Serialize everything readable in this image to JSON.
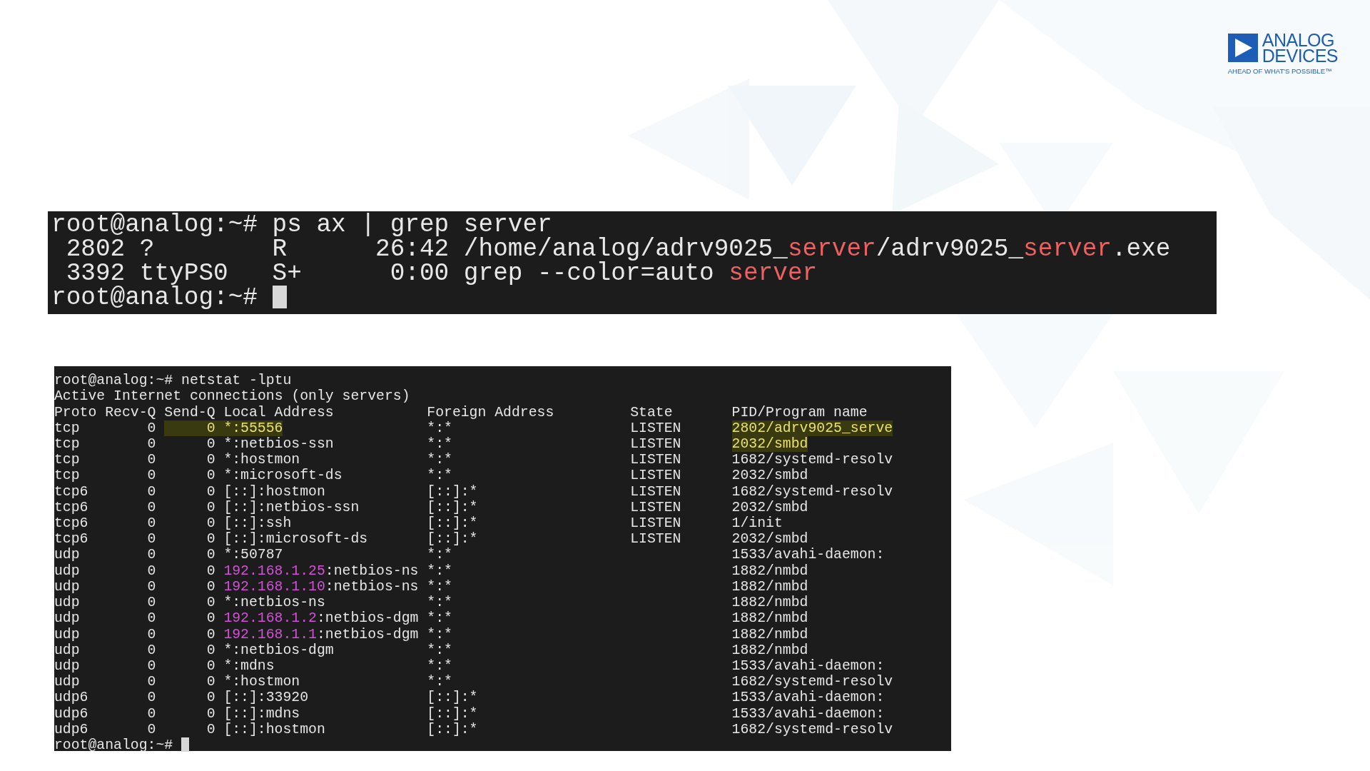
{
  "logo": {
    "name_lines": [
      "ANALOG",
      "DEVICES"
    ],
    "tagline": "AHEAD OF WHAT'S POSSIBLE™"
  },
  "terminal_1": {
    "lines": [
      [
        {
          "text": "root@analog:~# ps ax | grep server",
          "kind": "plain"
        }
      ],
      [
        {
          "text": " 2802 ?        R      26:42 /home/analog/adrv9025_",
          "kind": "plain"
        },
        {
          "text": "server",
          "kind": "match"
        },
        {
          "text": "/adrv9025_",
          "kind": "plain"
        },
        {
          "text": "server",
          "kind": "match"
        },
        {
          "text": ".exe",
          "kind": "plain"
        }
      ],
      [
        {
          "text": " 3392 ttyPS0   S+      0:00 grep --color=auto ",
          "kind": "plain"
        },
        {
          "text": "server",
          "kind": "match"
        }
      ],
      [
        {
          "text": "root@analog:~# ",
          "kind": "plain"
        }
      ]
    ],
    "cursor": true
  },
  "terminal_2": {
    "command": "root@analog:~# netstat -lptu",
    "title": "Active Internet connections (only servers)",
    "columns": [
      "Proto",
      "Recv-Q",
      "Send-Q",
      "Local Address",
      "Foreign Address",
      "State",
      "PID/Program name"
    ],
    "rows": [
      {
        "proto": "tcp",
        "recv_q": "0",
        "send_q": "0",
        "local": [
          {
            "text": "*:55556",
            "kind": "plain"
          }
        ],
        "foreign": "*:*",
        "state": "LISTEN",
        "program": "2802/adrv9025_serve",
        "address_highlighted": true,
        "program_highlighted": true
      },
      {
        "proto": "tcp",
        "recv_q": "0",
        "send_q": "0",
        "local": [
          {
            "text": "*:netbios-ssn",
            "kind": "plain"
          }
        ],
        "foreign": "*:*",
        "state": "LISTEN",
        "program": "2032/smbd",
        "address_highlighted": false,
        "program_highlighted": true
      },
      {
        "proto": "tcp",
        "recv_q": "0",
        "send_q": "0",
        "local": [
          {
            "text": "*:hostmon",
            "kind": "plain"
          }
        ],
        "foreign": "*:*",
        "state": "LISTEN",
        "program": "1682/systemd-resolv",
        "address_highlighted": false,
        "program_highlighted": false
      },
      {
        "proto": "tcp",
        "recv_q": "0",
        "send_q": "0",
        "local": [
          {
            "text": "*:microsoft-ds",
            "kind": "plain"
          }
        ],
        "foreign": "*:*",
        "state": "LISTEN",
        "program": "2032/smbd",
        "address_highlighted": false,
        "program_highlighted": false
      },
      {
        "proto": "tcp6",
        "recv_q": "0",
        "send_q": "0",
        "local": [
          {
            "text": "[::]:hostmon",
            "kind": "plain"
          }
        ],
        "foreign": "[::]:*",
        "state": "LISTEN",
        "program": "1682/systemd-resolv",
        "address_highlighted": false,
        "program_highlighted": false
      },
      {
        "proto": "tcp6",
        "recv_q": "0",
        "send_q": "0",
        "local": [
          {
            "text": "[::]:netbios-ssn",
            "kind": "plain"
          }
        ],
        "foreign": "[::]:*",
        "state": "LISTEN",
        "program": "2032/smbd",
        "address_highlighted": false,
        "program_highlighted": false
      },
      {
        "proto": "tcp6",
        "recv_q": "0",
        "send_q": "0",
        "local": [
          {
            "text": "[::]:ssh",
            "kind": "plain"
          }
        ],
        "foreign": "[::]:*",
        "state": "LISTEN",
        "program": "1/init",
        "address_highlighted": false,
        "program_highlighted": false
      },
      {
        "proto": "tcp6",
        "recv_q": "0",
        "send_q": "0",
        "local": [
          {
            "text": "[::]:microsoft-ds",
            "kind": "plain"
          }
        ],
        "foreign": "[::]:*",
        "state": "LISTEN",
        "program": "2032/smbd",
        "address_highlighted": false,
        "program_highlighted": false
      },
      {
        "proto": "udp",
        "recv_q": "0",
        "send_q": "0",
        "local": [
          {
            "text": "*:50787",
            "kind": "plain"
          }
        ],
        "foreign": "*:*",
        "program": "1533/avahi-daemon:",
        "address_highlighted": false,
        "program_highlighted": false
      },
      {
        "proto": "udp",
        "recv_q": "0",
        "send_q": "0",
        "local": [
          {
            "text": "192.168.1.25",
            "kind": "ip"
          },
          {
            "text": ":netbios-ns",
            "kind": "plain"
          }
        ],
        "foreign": "*:*",
        "program": "1882/nmbd",
        "address_highlighted": false,
        "program_highlighted": false
      },
      {
        "proto": "udp",
        "recv_q": "0",
        "send_q": "0",
        "local": [
          {
            "text": "192.168.1.10",
            "kind": "ip"
          },
          {
            "text": ":netbios-ns",
            "kind": "plain"
          }
        ],
        "foreign": "*:*",
        "program": "1882/nmbd",
        "address_highlighted": false,
        "program_highlighted": false
      },
      {
        "proto": "udp",
        "recv_q": "0",
        "send_q": "0",
        "local": [
          {
            "text": "*:netbios-ns",
            "kind": "plain"
          }
        ],
        "foreign": "*:*",
        "program": "1882/nmbd",
        "address_highlighted": false,
        "program_highlighted": false
      },
      {
        "proto": "udp",
        "recv_q": "0",
        "send_q": "0",
        "local": [
          {
            "text": "192.168.1.2",
            "kind": "ip"
          },
          {
            "text": ":netbios-dgm",
            "kind": "plain"
          }
        ],
        "foreign": "*:*",
        "program": "1882/nmbd",
        "address_highlighted": false,
        "program_highlighted": false
      },
      {
        "proto": "udp",
        "recv_q": "0",
        "send_q": "0",
        "local": [
          {
            "text": "192.168.1.1",
            "kind": "ip"
          },
          {
            "text": ":netbios-dgm",
            "kind": "plain"
          }
        ],
        "foreign": "*:*",
        "program": "1882/nmbd",
        "address_highlighted": false,
        "program_highlighted": false
      },
      {
        "proto": "udp",
        "recv_q": "0",
        "send_q": "0",
        "local": [
          {
            "text": "*:netbios-dgm",
            "kind": "plain"
          }
        ],
        "foreign": "*:*",
        "program": "1882/nmbd",
        "address_highlighted": false,
        "program_highlighted": false
      },
      {
        "proto": "udp",
        "recv_q": "0",
        "send_q": "0",
        "local": [
          {
            "text": "*:mdns",
            "kind": "plain"
          }
        ],
        "foreign": "*:*",
        "program": "1533/avahi-daemon:",
        "address_highlighted": false,
        "program_highlighted": false
      },
      {
        "proto": "udp",
        "recv_q": "0",
        "send_q": "0",
        "local": [
          {
            "text": "*:hostmon",
            "kind": "plain"
          }
        ],
        "foreign": "*:*",
        "program": "1682/systemd-resolv",
        "address_highlighted": false,
        "program_highlighted": false
      },
      {
        "proto": "udp6",
        "recv_q": "0",
        "send_q": "0",
        "local": [
          {
            "text": "[::]:33920",
            "kind": "plain"
          }
        ],
        "foreign": "[::]:*",
        "program": "1533/avahi-daemon:",
        "address_highlighted": false,
        "program_highlighted": false
      },
      {
        "proto": "udp6",
        "recv_q": "0",
        "send_q": "0",
        "local": [
          {
            "text": "[::]:mdns",
            "kind": "plain"
          }
        ],
        "foreign": "[::]:*",
        "program": "1533/avahi-daemon:",
        "address_highlighted": false,
        "program_highlighted": false
      },
      {
        "proto": "udp6",
        "recv_q": "0",
        "send_q": "0",
        "local": [
          {
            "text": "[::]:hostmon",
            "kind": "plain"
          }
        ],
        "foreign": "[::]:*",
        "program": "1682/systemd-resolv",
        "address_highlighted": false,
        "program_highlighted": false
      }
    ],
    "prompt": "root@analog:~# ",
    "cursor": true
  }
}
